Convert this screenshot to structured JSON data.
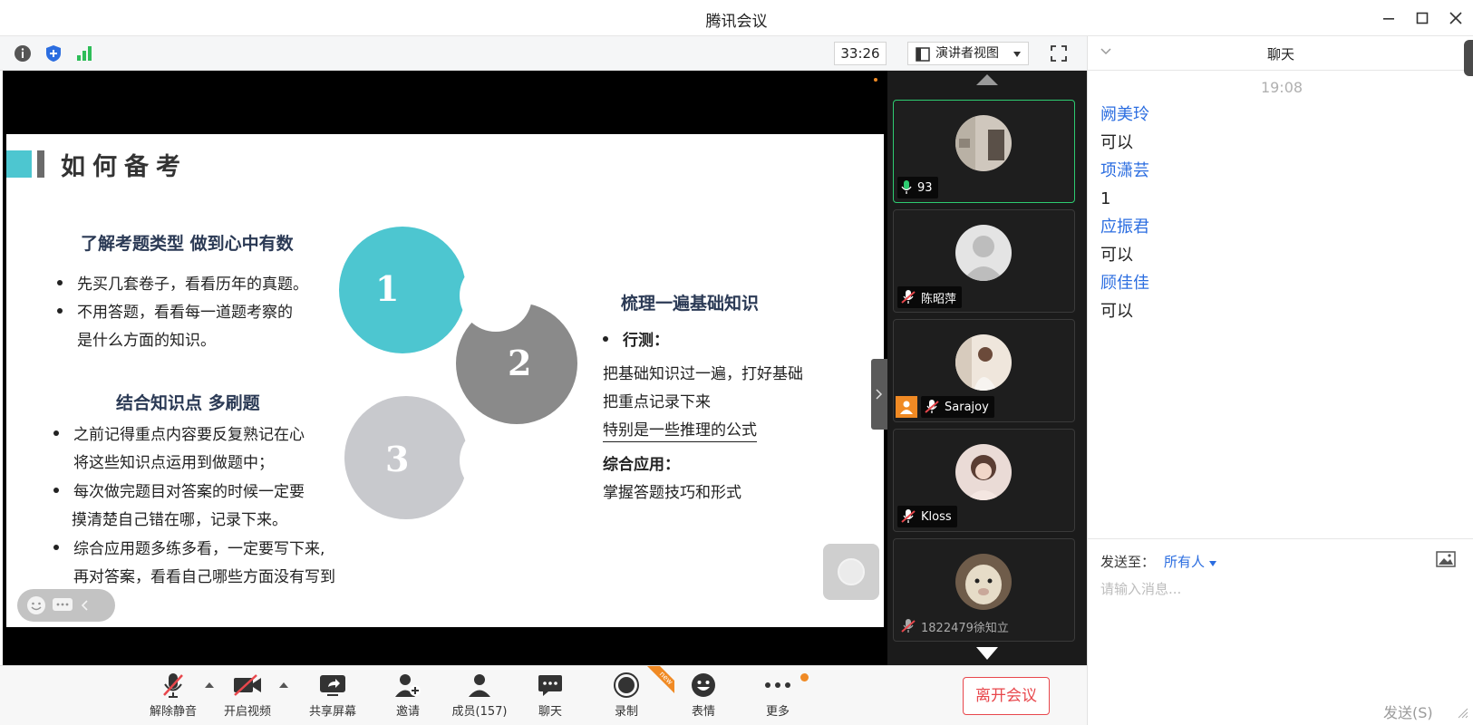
{
  "window": {
    "title": "腾讯会议"
  },
  "topbar": {
    "timer": "33:26",
    "view_mode": "演讲者视图"
  },
  "slide": {
    "title": "如何备考",
    "section1": {
      "heading": "了解考题类型 做到心中有数",
      "bullets": [
        "先买几套卷子，看看历年的真题。",
        "不用答题，看看每一道题考察的",
        "是什么方面的知识。"
      ]
    },
    "section2": {
      "heading": "结合知识点 多刷题",
      "lines": [
        "之前记得重点内容要反复熟记在心",
        "将这些知识点运用到做题中；",
        "每次做完题目对答案的时候一定要",
        "摸清楚自己错在哪，记录下来。",
        "综合应用题多练多看，一定要写下来,",
        "再对答案，看看自己哪些方面没有写到"
      ]
    },
    "section3": {
      "heading": "梳理一遍基础知识",
      "sub1": "行测：",
      "lines": [
        "把基础知识过一遍，打好基础",
        "把重点记录下来",
        "特别是一些推理的公式"
      ],
      "sub2": "综合应用：",
      "line_last": "掌握答题技巧和形式"
    },
    "circles": [
      {
        "num": "1",
        "color": "#4dc6d0"
      },
      {
        "num": "2",
        "color": "#8a8a8a"
      },
      {
        "num": "3",
        "color": "#c8c9cd"
      }
    ]
  },
  "participants": [
    {
      "name": "93",
      "mic": "on"
    },
    {
      "name": "陈昭萍",
      "mic": "off"
    },
    {
      "name": "Sarajoy",
      "mic": "off",
      "host": true
    },
    {
      "name": "Kloss",
      "mic": "off"
    },
    {
      "name": "1822479徐知立",
      "mic": "off"
    }
  ],
  "toolbar": {
    "unmute": "解除静音",
    "video": "开启视频",
    "share": "共享屏幕",
    "invite": "邀请",
    "members": "成员(157)",
    "chat": "聊天",
    "record": "录制",
    "emoji": "表情",
    "more": "更多",
    "leave": "离开会议",
    "new_badge": "new"
  },
  "chat": {
    "title": "聊天",
    "time": "19:08",
    "messages": [
      {
        "sender": "阙美玲",
        "text": "可以"
      },
      {
        "sender": "项潇芸",
        "text": "1"
      },
      {
        "sender": "应振君",
        "text": "可以"
      },
      {
        "sender": "顾佳佳",
        "text": "可以"
      }
    ],
    "send_to_label": "发送至：",
    "send_to_value": "所有人",
    "placeholder": "请输入消息...",
    "send_label": "发送(S)"
  },
  "colors": {
    "accent_blue": "#2b6de0",
    "leave_red": "#e8474c",
    "active_green": "#2ecc71",
    "host_orange": "#f08a24"
  }
}
